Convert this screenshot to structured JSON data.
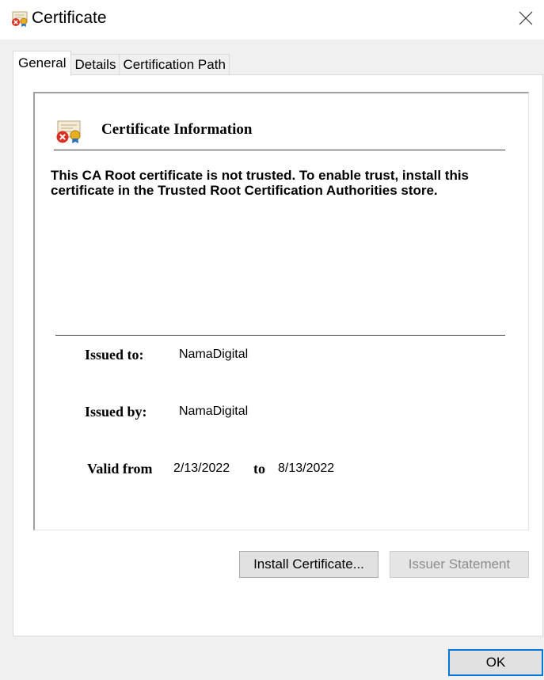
{
  "window": {
    "title": "Certificate",
    "title_icon": "certificate-error-icon",
    "close_icon": "close-icon"
  },
  "tabs": [
    {
      "label": "General",
      "active": true
    },
    {
      "label": "Details",
      "active": false
    },
    {
      "label": "Certification Path",
      "active": false
    }
  ],
  "info": {
    "icon": "certificate-error-icon",
    "heading": "Certificate Information",
    "warning": "This CA Root certificate is not trusted. To enable trust, install this certificate in the Trusted Root Certification Authorities store.",
    "issued_to_label": "Issued to:",
    "issued_to_value": "NamaDigital",
    "issued_by_label": "Issued by:",
    "issued_by_value": "NamaDigital",
    "valid_from_label": "Valid from",
    "valid_from_value": "2/13/2022",
    "valid_to_label": "to",
    "valid_to_value": "8/13/2022"
  },
  "buttons": {
    "install_certificate": "Install Certificate...",
    "issuer_statement": "Issuer Statement",
    "ok": "OK"
  },
  "colors": {
    "accent": "#0078d7",
    "disabled_text": "#8d8d8d"
  }
}
